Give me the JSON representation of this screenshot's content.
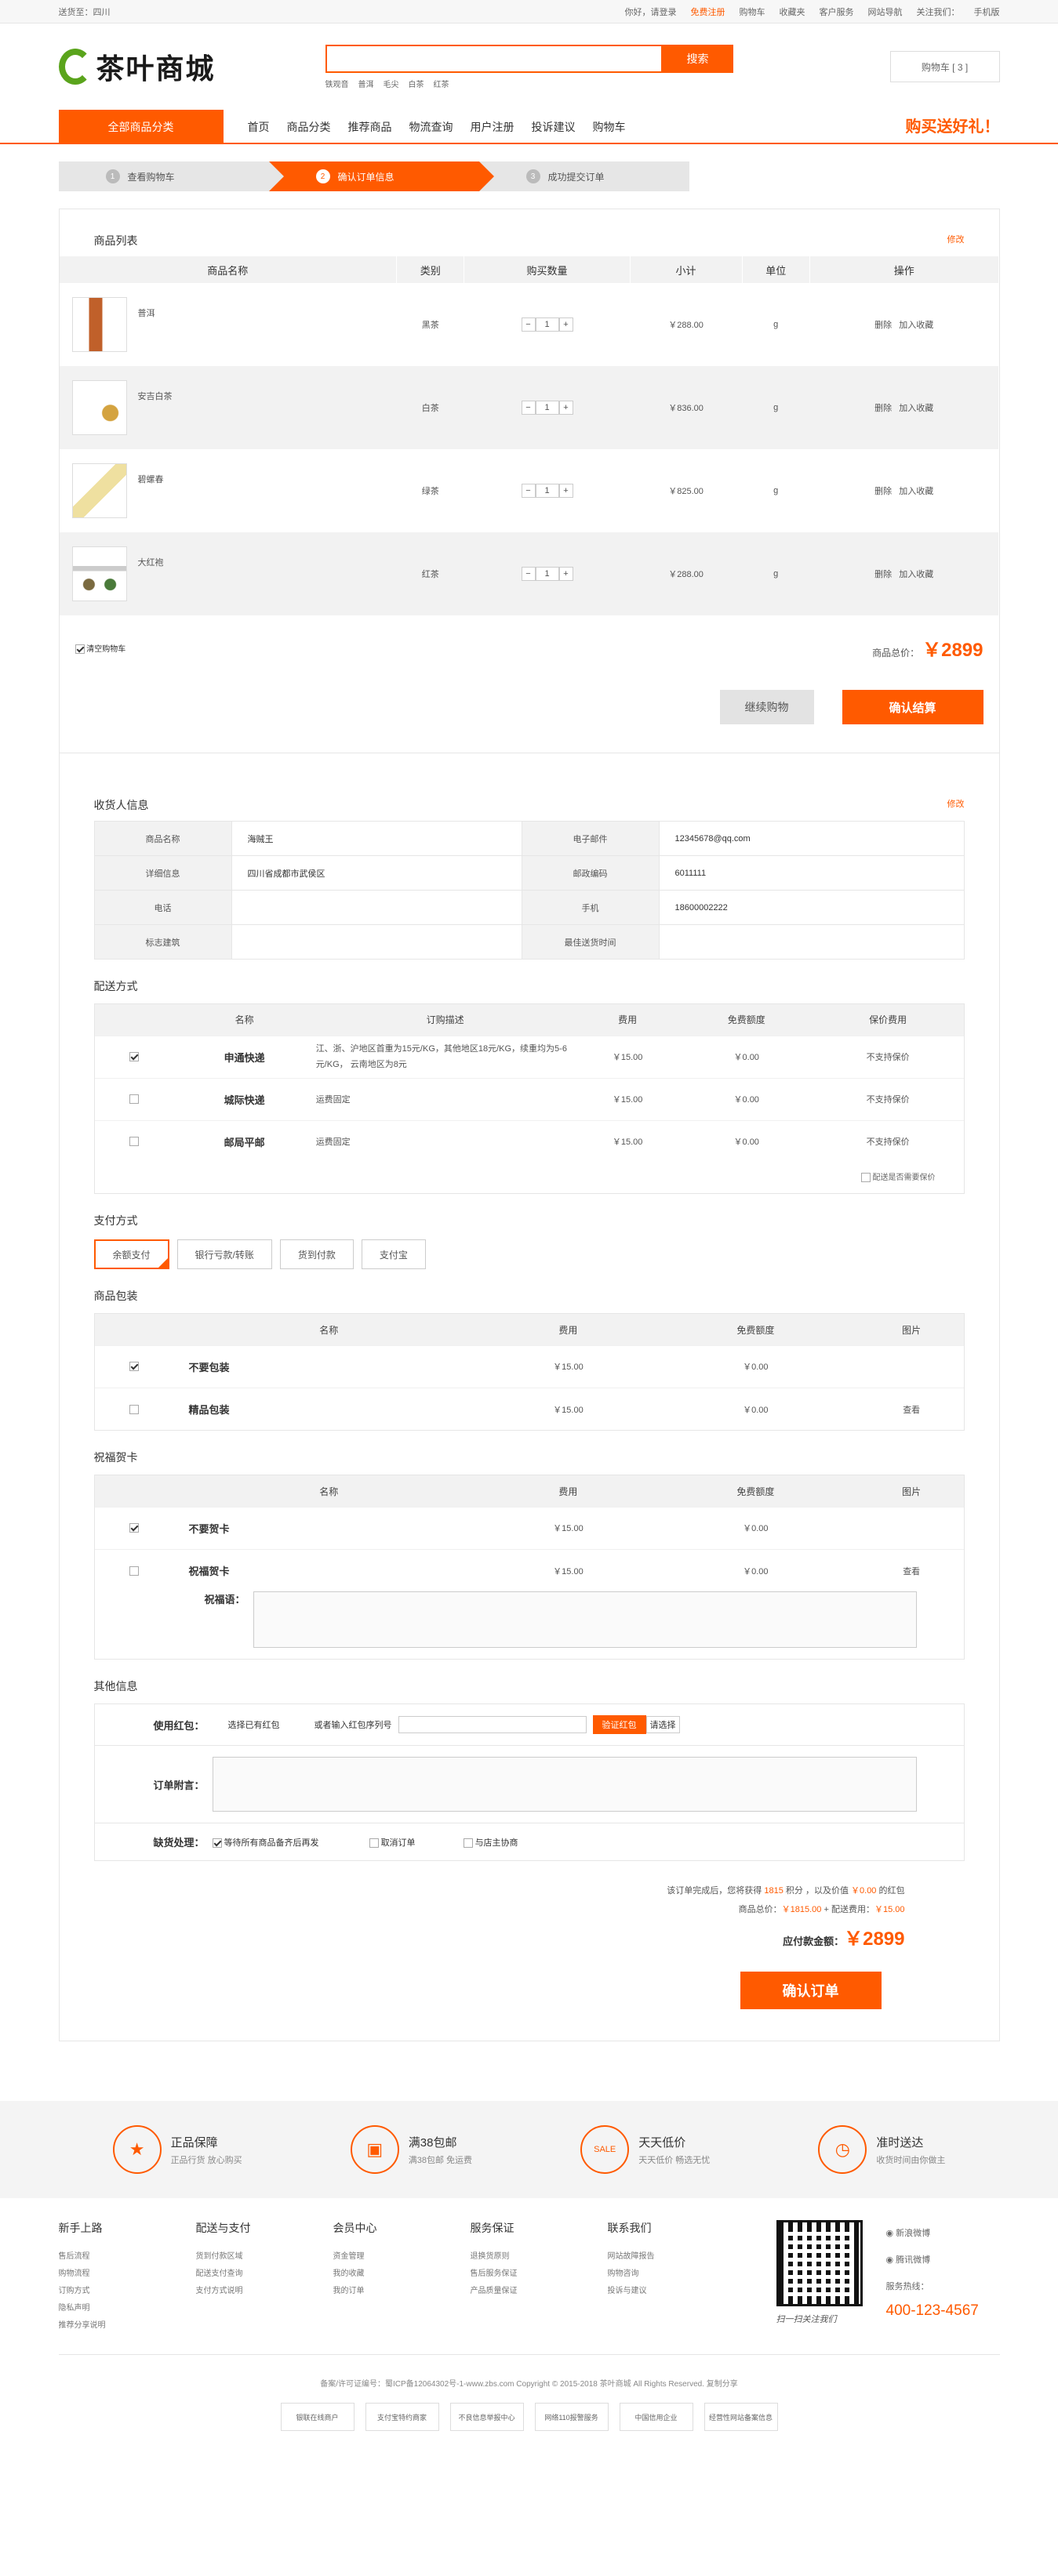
{
  "topbar": {
    "location": "送货至：四川",
    "greet": "你好，请登录",
    "register": "免费注册",
    "links": [
      "购物车",
      "收藏夹",
      "客户服务",
      "网站导航"
    ],
    "follow": "关注我们：",
    "mobile": "手机版"
  },
  "header": {
    "logo": "茶叶商城",
    "search_btn": "搜索",
    "hot": [
      "铁观音",
      "普洱",
      "毛尖",
      "白茶",
      "红茶"
    ],
    "cart": "购物车 [ 3 ]"
  },
  "nav": {
    "category": "全部商品分类",
    "items": [
      "首页",
      "商品分类",
      "推荐商品",
      "物流查询",
      "用户注册",
      "投诉建议",
      "购物车"
    ],
    "promo": "购买送好礼！"
  },
  "steps": [
    {
      "num": "1",
      "label": "查看购物车"
    },
    {
      "num": "2",
      "label": "确认订单信息"
    },
    {
      "num": "3",
      "label": "成功提交订单"
    }
  ],
  "goods": {
    "title": "商品列表",
    "edit": "修改",
    "headers": [
      "商品名称",
      "类别",
      "购买数量",
      "小计",
      "单位",
      "操作"
    ],
    "rows": [
      {
        "name": "普洱",
        "type": "黑茶",
        "qty": "1",
        "subtotal": "￥288.00",
        "unit": "g",
        "del": "删除",
        "fav": "加入收藏"
      },
      {
        "name": "安吉白茶",
        "type": "白茶",
        "qty": "1",
        "subtotal": "￥836.00",
        "unit": "g",
        "del": "删除",
        "fav": "加入收藏"
      },
      {
        "name": "碧螺春",
        "type": "绿茶",
        "qty": "1",
        "subtotal": "￥825.00",
        "unit": "g",
        "del": "删除",
        "fav": "加入收藏"
      },
      {
        "name": "大红袍",
        "type": "红茶",
        "qty": "1",
        "subtotal": "￥288.00",
        "unit": "g",
        "del": "删除",
        "fav": "加入收藏"
      }
    ],
    "clear": "清空购物车",
    "total_label": "商品总价：",
    "total": "￥2899",
    "continue": "继续购物",
    "checkout": "确认结算"
  },
  "receiver": {
    "title": "收货人信息",
    "edit": "修改",
    "rows": [
      [
        "商品名称",
        "海贼王",
        "电子邮件",
        "12345678@qq.com"
      ],
      [
        "详细信息",
        "四川省成都市武侯区",
        "邮政编码",
        "6011111"
      ],
      [
        "电话",
        "",
        "手机",
        "18600002222"
      ],
      [
        "标志建筑",
        "",
        "最佳送货时间",
        ""
      ]
    ]
  },
  "shipping": {
    "title": "配送方式",
    "headers": [
      "名称",
      "订购描述",
      "费用",
      "免费额度",
      "保价费用"
    ],
    "rows": [
      {
        "name": "申通快递",
        "desc": "江、浙、沪地区首重为15元/KG，其他地区18元/KG，续重均为5-6元/KG， 云南地区为8元",
        "fee": "￥15.00",
        "free": "￥0.00",
        "ins": "不支持保价"
      },
      {
        "name": "城际快递",
        "desc": "运费固定",
        "fee": "￥15.00",
        "free": "￥0.00",
        "ins": "不支持保价"
      },
      {
        "name": "邮局平邮",
        "desc": "运费固定",
        "fee": "￥15.00",
        "free": "￥0.00",
        "ins": "不支持保价"
      }
    ],
    "insure": "配送是否需要保价"
  },
  "payment": {
    "title": "支付方式",
    "options": [
      "余额支付",
      "银行亏款/转账",
      "货到付款",
      "支付宝"
    ]
  },
  "packaging": {
    "title": "商品包装",
    "headers": [
      "名称",
      "费用",
      "免费额度",
      "图片"
    ],
    "rows": [
      {
        "name": "不要包装",
        "fee": "￥15.00",
        "free": "￥0.00",
        "pic": ""
      },
      {
        "name": "精品包装",
        "fee": "￥15.00",
        "free": "￥0.00",
        "pic": "查看"
      }
    ]
  },
  "card": {
    "title": "祝福贺卡",
    "headers": [
      "名称",
      "费用",
      "免费额度",
      "图片"
    ],
    "rows": [
      {
        "name": "不要贺卡",
        "fee": "￥15.00",
        "free": "￥0.00",
        "pic": ""
      },
      {
        "name": "祝福贺卡",
        "fee": "￥15.00",
        "free": "￥0.00",
        "pic": "查看"
      }
    ],
    "msg_label": "祝福语："
  },
  "other": {
    "title": "其他信息",
    "coupon_label": "使用红包：",
    "coupon_sel": "选择已有红包",
    "coupon_input": "或者输入红包序列号",
    "coupon_btn": "验证红包",
    "coupon_select": "请选择",
    "note_label": "订单附言：",
    "stock_label": "缺货处理：",
    "stock_opts": [
      "等待所有商品备齐后再发",
      "取消订单",
      "与店主协商"
    ]
  },
  "final": {
    "line1a": "该订单完成后，您将获得 ",
    "points": "1815",
    "line1b": " 积分 ，以及价值 ",
    "gift": "￥0.00",
    "line1c": " 的红包",
    "line2a": "商品总价：",
    "goods_total": "￥1815.00",
    "line2b": " + 配送费用：",
    "ship_total": "￥15.00",
    "pay_label": "应付款金额：",
    "pay_total": "￥2899",
    "confirm": "确认订单"
  },
  "guarantee": [
    {
      "t": "正品保障",
      "s": "正品行货 放心购买",
      "i": "★"
    },
    {
      "t": "满38包邮",
      "s": "满38包邮 免运费",
      "i": "▣"
    },
    {
      "t": "天天低价",
      "s": "天天低价 畅选无忧",
      "i": "SALE"
    },
    {
      "t": "准时送达",
      "s": "收货时间由你做主",
      "i": "◷"
    }
  ],
  "footer": {
    "cols": [
      {
        "h": "新手上路",
        "l": [
          "售后流程",
          "购物流程",
          "订购方式",
          "隐私声明",
          "推荐分享说明"
        ]
      },
      {
        "h": "配送与支付",
        "l": [
          "货到付款区域",
          "配送支付查询",
          "支付方式说明"
        ]
      },
      {
        "h": "会员中心",
        "l": [
          "资金管理",
          "我的收藏",
          "我的订单"
        ]
      },
      {
        "h": "服务保证",
        "l": [
          "退换货原则",
          "售后服务保证",
          "产品质量保证"
        ]
      },
      {
        "h": "联系我们",
        "l": [
          "网站故障报告",
          "购物咨询",
          "投诉与建议"
        ]
      }
    ],
    "qr_text": "扫一扫关注我们",
    "weibo": "新浪微博",
    "tweibo": "腾讯微博",
    "hotline": "服务热线：",
    "phone": "400-123-4567",
    "copy": "备案/许可证编号：蜀ICP备12064302号-1-www.zbs.com Copyright © 2015-2018 茶叶商城 All Rights Reserved. 复制分享",
    "badges": [
      "银联在线商户",
      "支付宝特约商家",
      "不良信息举报中心",
      "网络110报警服务",
      "中国信用企业",
      "经营性网站备案信息"
    ]
  }
}
